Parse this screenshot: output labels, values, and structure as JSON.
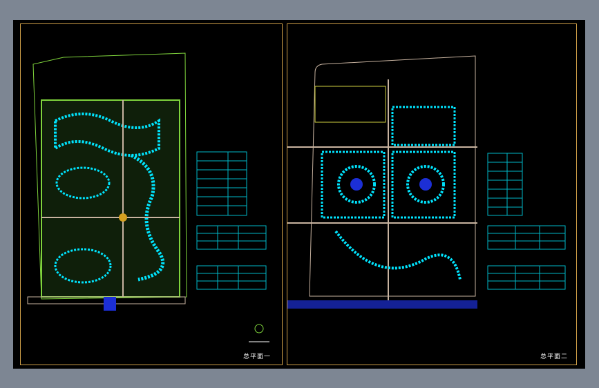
{
  "sheets": [
    {
      "title": "总平面一"
    },
    {
      "title": "总平面二"
    }
  ],
  "colors": {
    "background": "#000000",
    "frame": "#d0a048",
    "road": "#c8b3a0",
    "building": "#00e5ff",
    "green": "#7fd43c",
    "table_cell": "#00b8c8",
    "table_text": "#ffaa00",
    "water": "#1c2fd6"
  }
}
